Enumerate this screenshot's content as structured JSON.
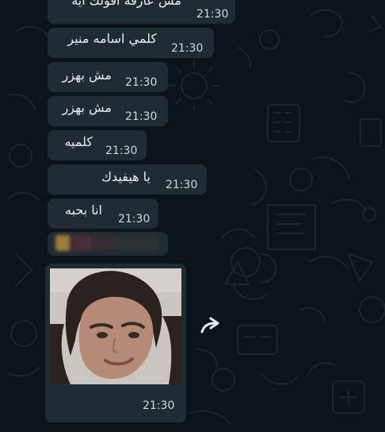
{
  "chat": {
    "messages": [
      {
        "text": "مش عارفة أقولك أيه",
        "time": "21:30"
      },
      {
        "text": "كلمي اسامه منير",
        "time": "21:30"
      },
      {
        "text": "مش بهزر",
        "time": "21:30"
      },
      {
        "text": "مش بهزر",
        "time": "21:30"
      },
      {
        "text": "كلميه",
        "time": "21:30"
      },
      {
        "text": "يا       هيفيدك",
        "time": "21:30"
      },
      {
        "text": "انا بحبه",
        "time": "21:30"
      }
    ],
    "photo_message": {
      "time": "21:30"
    }
  },
  "icons": {
    "forward": "forward-icon",
    "redacted": "redacted-emoji-strip"
  },
  "colors": {
    "background": "#0b141a",
    "bubble": "#202c33",
    "text": "#e9edef",
    "time": "#d1d7db"
  }
}
